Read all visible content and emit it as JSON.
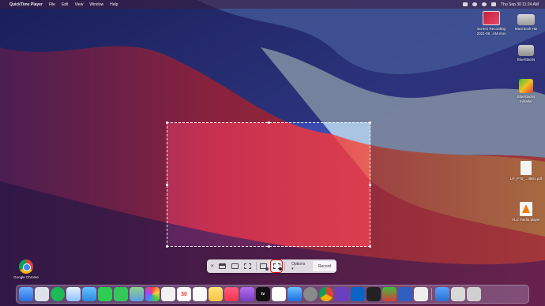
{
  "menubar": {
    "app_name": "QuickTime Player",
    "items": [
      "File",
      "Edit",
      "View",
      "Window",
      "Help"
    ],
    "clock": "Thu Sep 30  11:24 AM"
  },
  "desktop_icons": [
    {
      "label": "Screen Recording\n2021-09...AM.mov",
      "icon": "video-file-icon"
    },
    {
      "label": "Macintosh HD",
      "icon": "hard-drive-icon"
    },
    {
      "label": "BlueStacks",
      "icon": "disk-icon"
    },
    {
      "label": "BlueStacks\nInstaller",
      "icon": "bluestacks-icon"
    },
    {
      "label": "LP_PT0_...4801.pdf",
      "icon": "document-icon"
    },
    {
      "label": "VLC media player",
      "icon": "vlc-icon"
    },
    {
      "label": "Google Chrome",
      "icon": "chrome-icon"
    }
  ],
  "capture_toolbar": {
    "close_symbol": "✕",
    "options_label": "Options ▾",
    "record_label": "Record",
    "active_tool": "record-selected-portion"
  },
  "dock": {
    "calendar_day": "30",
    "tv_label": "tv"
  },
  "colors": {
    "highlight": "#e0141e",
    "wallpaper_blue": "#2a3f9d",
    "wallpaper_red": "#e23a5a",
    "wallpaper_orange": "#f08a4a"
  }
}
